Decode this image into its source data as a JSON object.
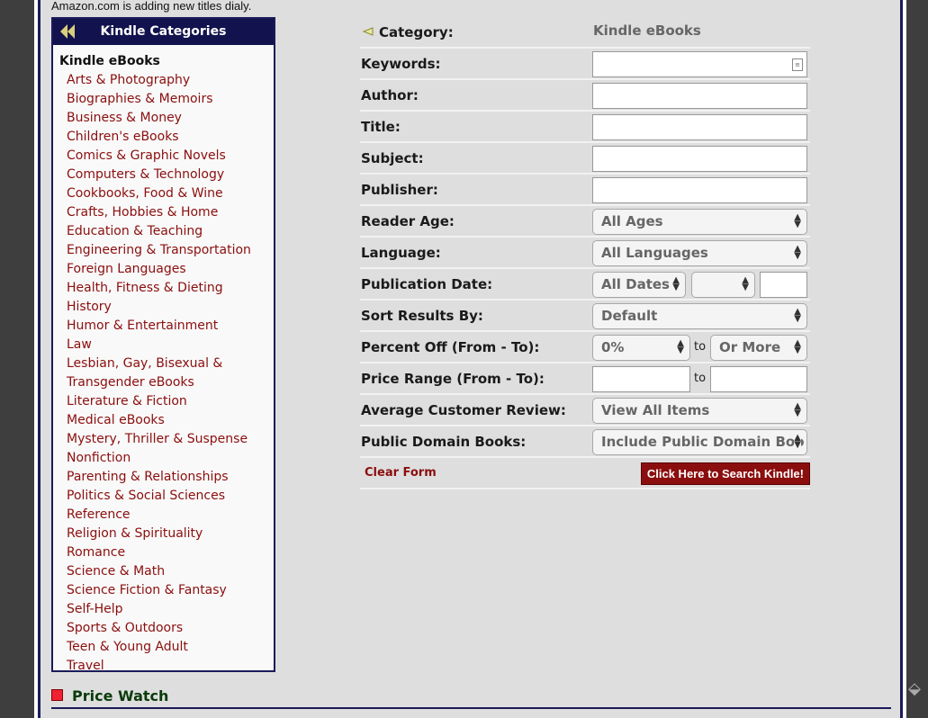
{
  "top_note": "Amazon.com is adding new titles dialy.",
  "sidebar": {
    "title": "Kindle Categories",
    "section_title": "Kindle eBooks",
    "items": [
      "Arts & Photography",
      "Biographies & Memoirs",
      "Business & Money",
      "Children's eBooks",
      "Comics & Graphic Novels",
      "Computers & Technology",
      "Cookbooks, Food & Wine",
      "Crafts, Hobbies & Home",
      "Education & Teaching",
      "Engineering & Transportation",
      "Foreign Languages",
      "Health, Fitness & Dieting",
      "History",
      "Humor & Entertainment",
      "Law",
      "Lesbian, Gay, Bisexual & Transgender eBooks",
      "Literature & Fiction",
      "Medical eBooks",
      "Mystery, Thriller & Suspense",
      "Nonfiction",
      "Parenting & Relationships",
      "Politics & Social Sciences",
      "Reference",
      "Religion & Spirituality",
      "Romance",
      "Science & Math",
      "Science Fiction & Fantasy",
      "Self-Help",
      "Sports & Outdoors",
      "Teen & Young Adult",
      "Travel"
    ]
  },
  "form": {
    "category_label": "Category:",
    "category_value": "Kindle eBooks",
    "keywords_label": "Keywords:",
    "author_label": "Author:",
    "title_label": "Title:",
    "subject_label": "Subject:",
    "publisher_label": "Publisher:",
    "reader_age_label": "Reader Age:",
    "reader_age_value": "All Ages",
    "language_label": "Language:",
    "language_value": "All Languages",
    "pub_date_label": "Publication Date:",
    "pub_date_value": "All Dates",
    "sort_label": "Sort Results By:",
    "sort_value": "Default",
    "percent_label": "Percent Off (From - To):",
    "percent_from": "0%",
    "percent_to": "Or More",
    "to_text": "to",
    "price_label": "Price Range (From - To):",
    "review_label": "Average Customer Review:",
    "review_value": "View All Items",
    "public_label": "Public Domain Books:",
    "public_value": "Include Public Domain Boo",
    "clear_label": "Clear Form",
    "search_label": "Click Here to Search Kindle!"
  },
  "price_watch": "Price Watch",
  "colors": {
    "link": "#8b0e0e",
    "navy": "#12124e",
    "button": "#8b0e0e"
  }
}
